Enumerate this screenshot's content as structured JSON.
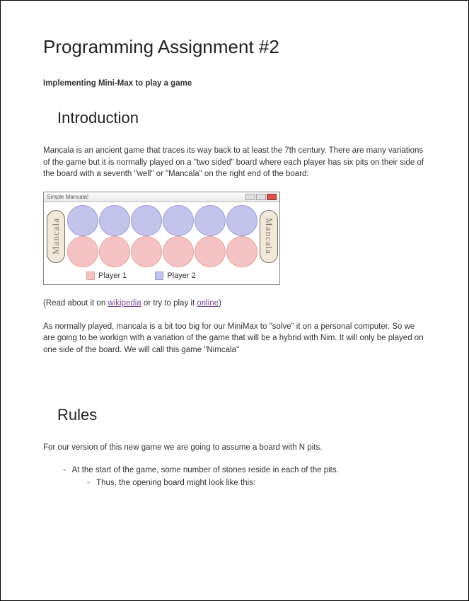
{
  "title": "Programming Assignment #2",
  "subtitle": "Implementing Mini-Max to play a game",
  "intro": {
    "heading": "Introduction",
    "para1": "Mancala is an ancient game that traces its way back to at least the 7th century. There are many variations of the game but it is normally played on a \"two sided\" board where each player has six pits on their side of the board with a seventh \"well\" or \"Mancala\" on the right end of the board:",
    "read_prefix": "(Read about it on ",
    "link1_text": "wikipedia",
    "read_mid": " or try to play it ",
    "link2_text": "online",
    "read_suffix": ")",
    "para2": "As normally played, mancala is a bit too big for our MiniMax to \"solve\" it on a personal computer.  So we are going to be workign with a variation of the game that will be a hybrid with Nim.  It will only be played on one side of the board. We will call this game \"Nimcala\""
  },
  "board": {
    "window_title": "Simple Mancala!",
    "well_left_label": "Mancala",
    "well_right_label": "Mancala",
    "legend_p1": "Player 1",
    "legend_p2": "Player 2"
  },
  "rules": {
    "heading": "Rules",
    "intro_line": "For our version of this new game we are going to assume a board with N pits.",
    "bullet1": "At the start of the game, some number of stones reside in each of the pits.",
    "bullet1_sub": "Thus, the opening board might look like this:"
  }
}
